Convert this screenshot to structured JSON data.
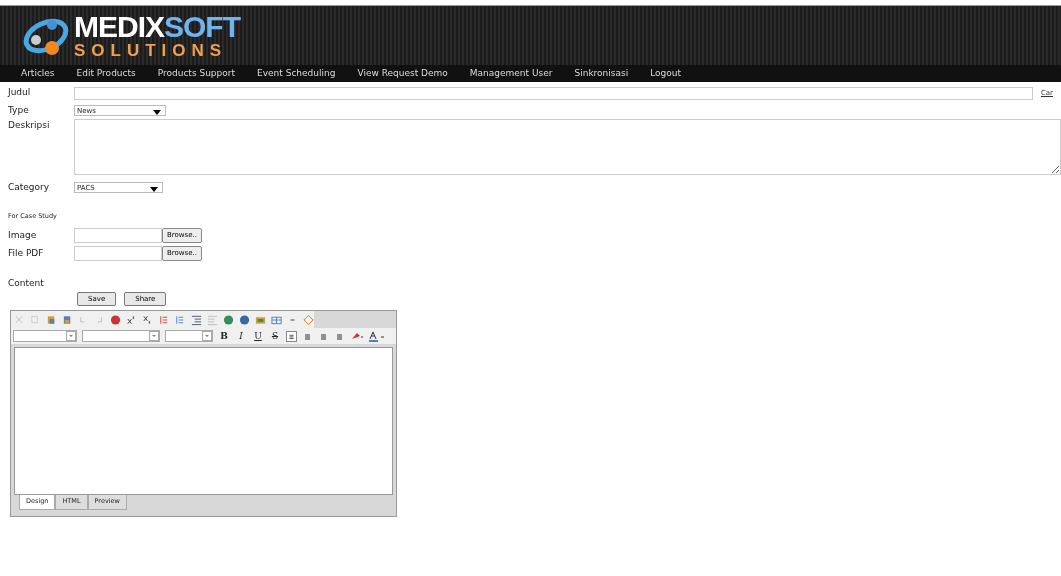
{
  "logo": {
    "line1a": "MEDIX",
    "line1b": "SOFT",
    "line2": "SOLUTIONS"
  },
  "nav": [
    {
      "label": "Articles"
    },
    {
      "label": "Edit Products"
    },
    {
      "label": "Products Support"
    },
    {
      "label": "Event Scheduling"
    },
    {
      "label": "View Request Demo"
    },
    {
      "label": "Management User"
    },
    {
      "label": "Sinkronisasi"
    },
    {
      "label": "Logout"
    }
  ],
  "form": {
    "judul": {
      "label": "Judul",
      "link": "Car"
    },
    "type": {
      "label": "Type",
      "value": "News"
    },
    "deskripsi": {
      "label": "Deskripsi"
    },
    "category": {
      "label": "Category",
      "value": "PACS"
    },
    "case_study_heading": "For Case Study",
    "files": [
      {
        "label": "Image",
        "button": "Browse.."
      },
      {
        "label": "File PDF",
        "button": "Browse.."
      }
    ],
    "content_label": "Content",
    "buttons": [
      "Save",
      "Share"
    ]
  },
  "editor": {
    "format_buttons": [
      {
        "kind": "bold",
        "text": "B"
      },
      {
        "kind": "italic",
        "text": "I"
      },
      {
        "kind": "underline",
        "text": "U"
      },
      {
        "kind": "strike",
        "text": "S"
      }
    ],
    "tabs": [
      {
        "label": "Design",
        "selected": true
      },
      {
        "label": "HTML",
        "selected": false
      },
      {
        "label": "Preview",
        "selected": false
      }
    ]
  }
}
